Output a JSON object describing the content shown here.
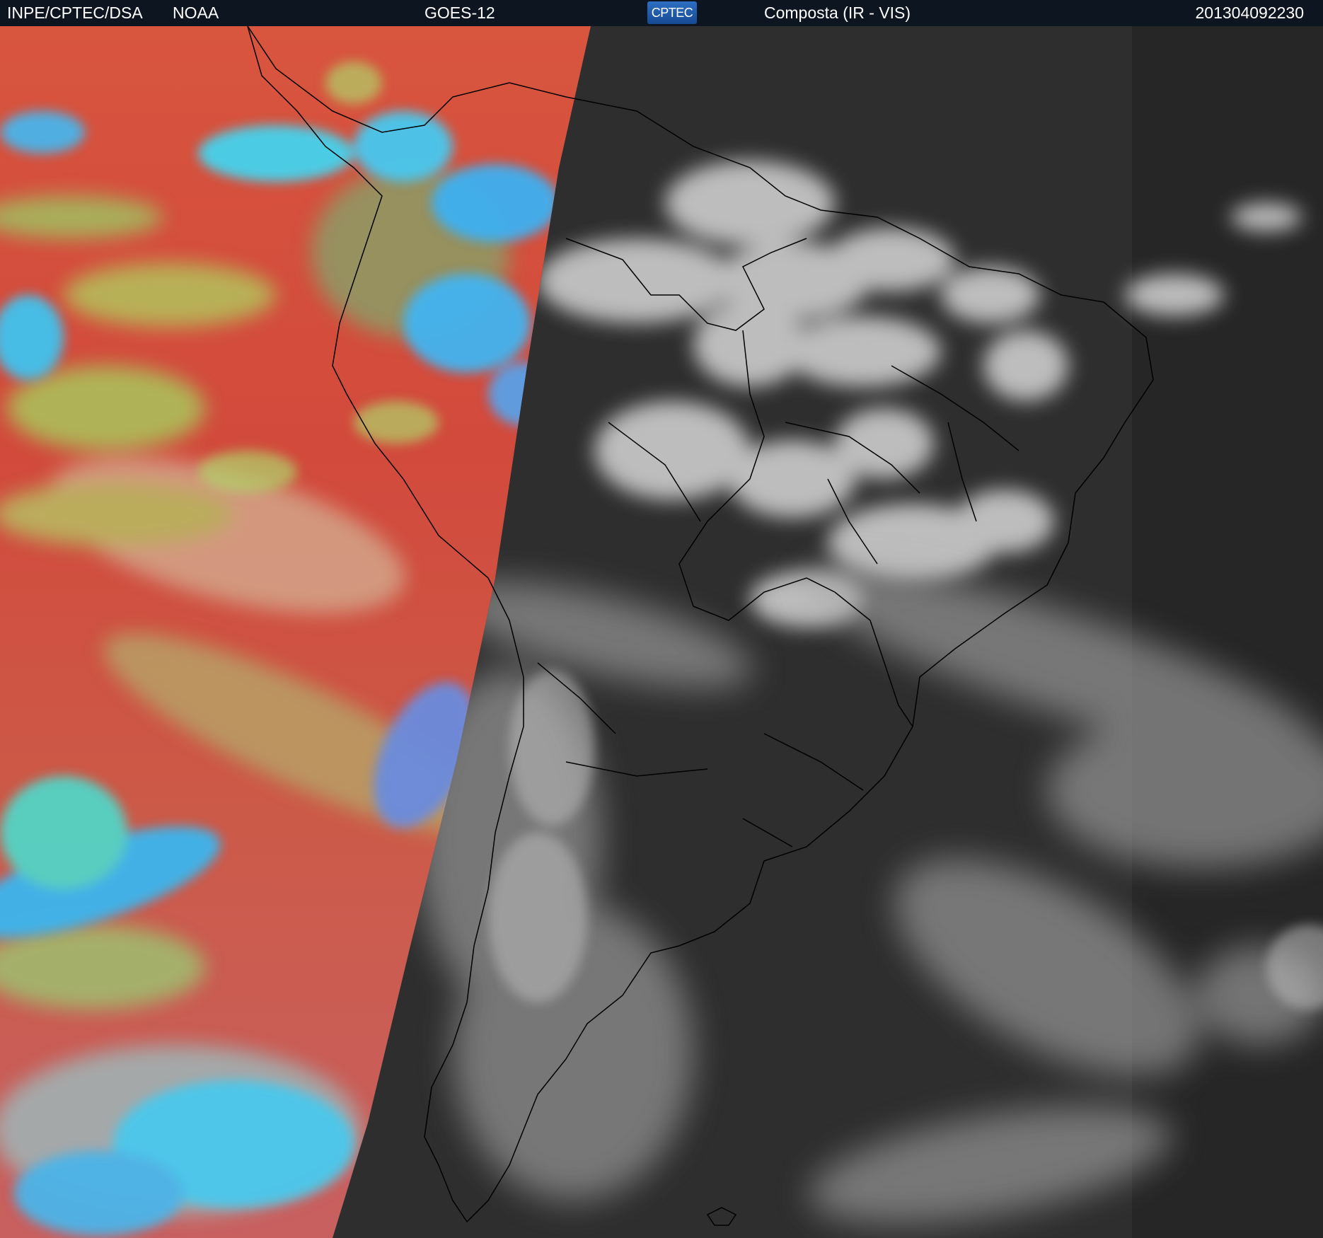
{
  "header": {
    "agency_label": "INPE/CPTEC/DSA",
    "source_label": "NOAA",
    "satellite_label": "GOES-12",
    "logo_text": "CPTEC",
    "product_label": "Composta (IR - VIS)",
    "timestamp_label": "201304092230"
  },
  "colors": {
    "header_background": "#0d1620",
    "header_text": "#ffffff",
    "infrared_ocean": "#d04a3c",
    "infrared_cold_cloud": "#3cc8ee",
    "infrared_mid_cloud": "#a6c454",
    "visible_background": "#2f2f2f",
    "visible_cloud": "#d8d8d8",
    "border_lines": "#000000"
  },
  "map": {
    "region": "South America",
    "left_panel": "infrared color composite",
    "right_panel": "visible grayscale"
  }
}
